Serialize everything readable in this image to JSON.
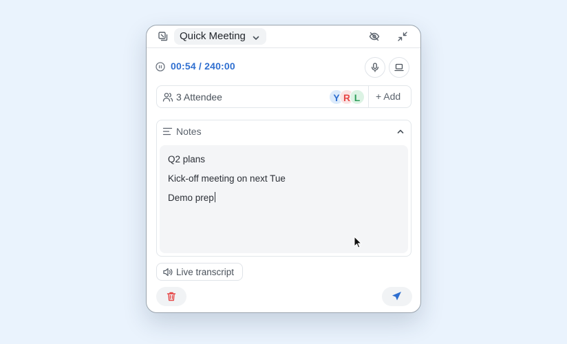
{
  "header": {
    "title": "Quick Meeting",
    "icons": [
      "copy-window-icon",
      "chevron-down-icon",
      "eye-off-icon",
      "collapse-icon"
    ]
  },
  "timer": {
    "elapsed": "00:54",
    "separator": " / ",
    "total": "240:00",
    "color": "#2f6fd0"
  },
  "attendees": {
    "label": "3 Attendee",
    "avatars": [
      {
        "initial": "Y",
        "color": "#2f6fd0",
        "bg": "#dcebfb"
      },
      {
        "initial": "R",
        "color": "#e64545",
        "bg": "#fbe3e3"
      },
      {
        "initial": "L",
        "color": "#2f9e5a",
        "bg": "#dcf3e4"
      }
    ],
    "add_label": "+ Add"
  },
  "notes": {
    "label": "Notes",
    "lines": [
      "Q2 plans",
      "Kick-off meeting on next Tue",
      "Demo prep"
    ]
  },
  "live_transcript": {
    "label": "Live transcript"
  },
  "colors": {
    "accent": "#2f6fd0",
    "danger": "#e64545",
    "background": "#eaf3fd"
  }
}
